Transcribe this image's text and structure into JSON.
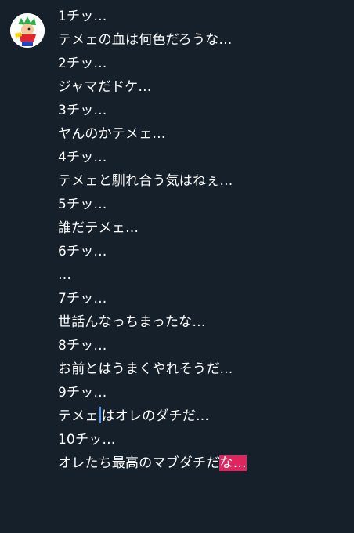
{
  "lines": [
    "1チッ…",
    "テメェの血は何色だろうな…",
    "2チッ…",
    "ジャマだドケ…",
    "3チッ…",
    "ヤんのかテメェ…",
    "4チッ…",
    "テメェと馴れ合う気はねぇ…",
    "5チッ…",
    "誰だテメェ…",
    "6チッ…",
    "…",
    "7チッ…",
    "世話んなっちまったな…",
    "8チッ…",
    "お前とはうまくやれそうだ…",
    "9チッ…",
    "テメェ",
    "はオレのダチだ…",
    "10チッ…",
    "オレたち最高のマブダチだ",
    "な…"
  ],
  "icons": {
    "avatar": "character-avatar-icon"
  },
  "colors": {
    "background": "#16202b",
    "text": "#ffffff",
    "caret": "#4a9bff",
    "highlight": "#e0245e"
  }
}
